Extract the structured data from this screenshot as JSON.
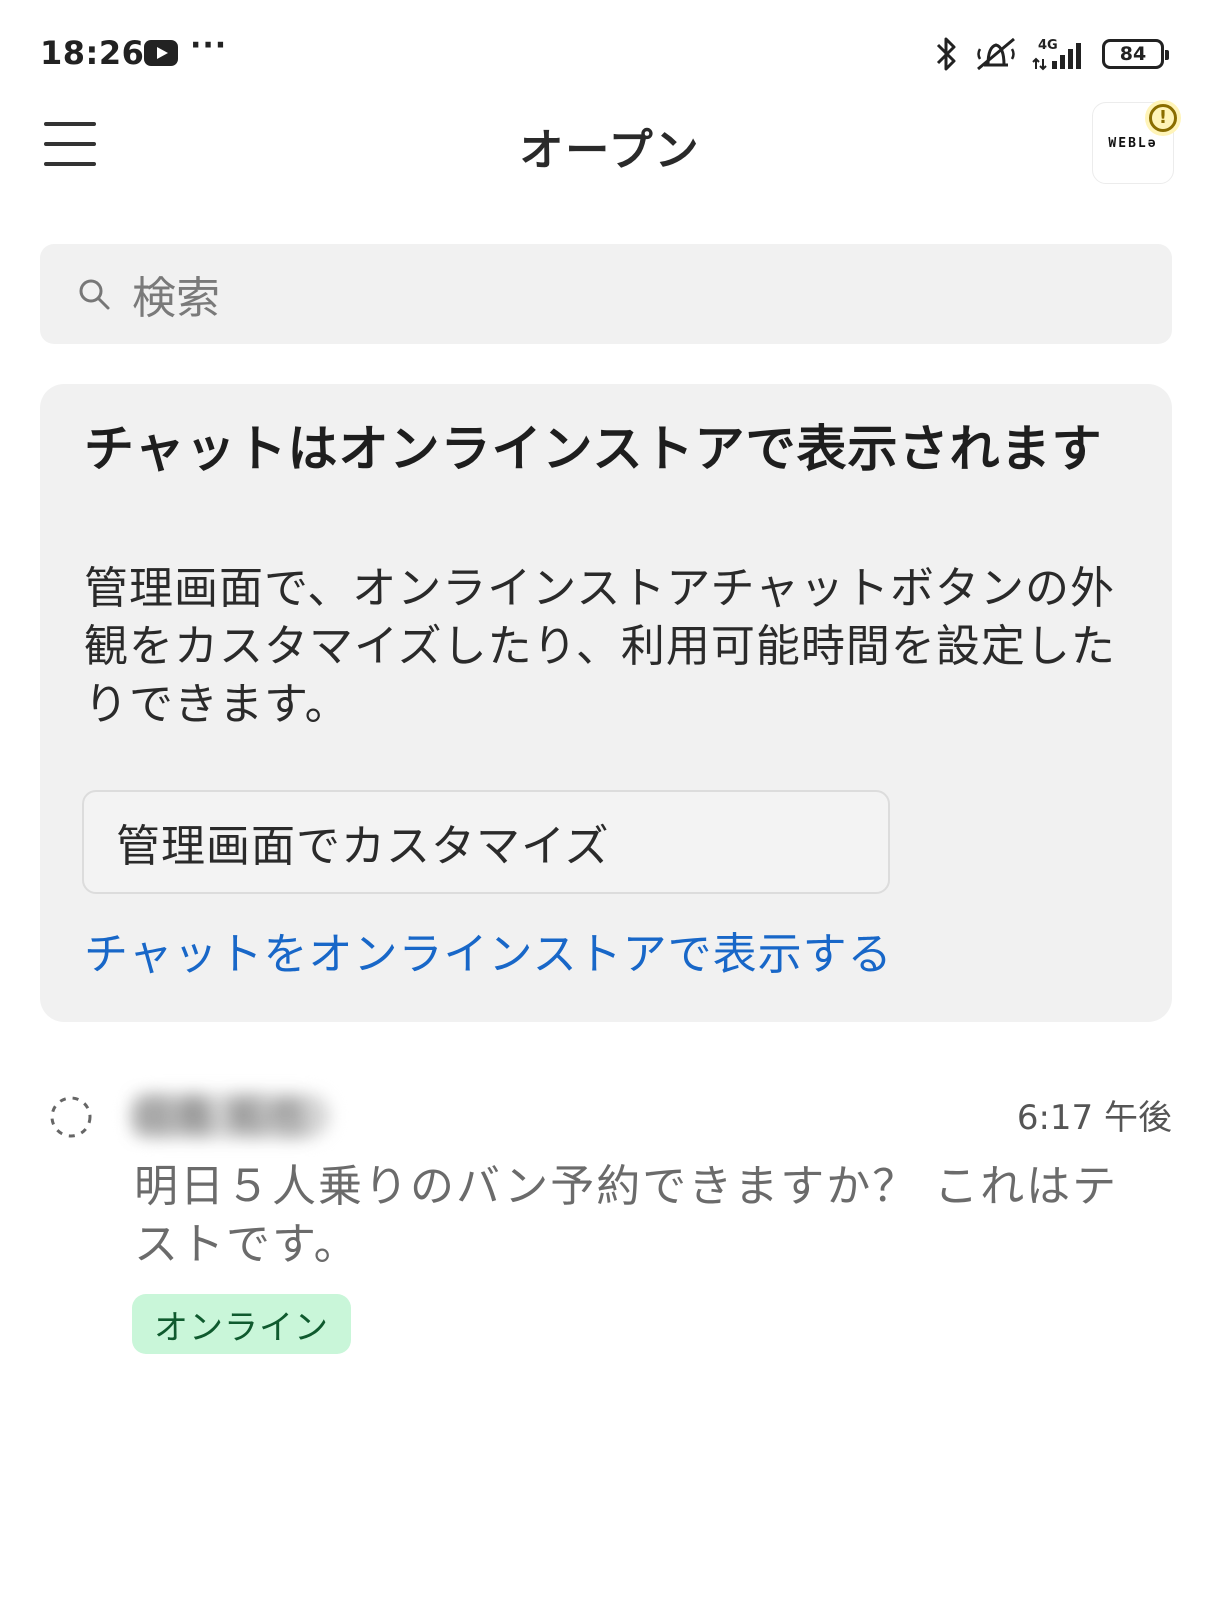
{
  "status_bar": {
    "time": "18:26",
    "more": "···",
    "network": "4G",
    "battery": "84"
  },
  "header": {
    "title": "オープン",
    "avatar_text": "WEBLə"
  },
  "search": {
    "placeholder": "検索"
  },
  "banner": {
    "title": "チャットはオンラインストアで表示されます",
    "body": "管理画面で、オンラインストアチャットボタンの外観をカスタマイズしたり、利用可能時間を設定したりできます。",
    "button_label": "管理画面でカスタマイズ",
    "link_label": "チャットをオンラインストアで表示する"
  },
  "conversations": [
    {
      "customer_name": "田島 拓也",
      "time": "6:17 午後",
      "preview": "明日５人乗りのバン予約できますか？ これはテストです。",
      "status_badge": "オンライン"
    }
  ],
  "colors": {
    "link": "#1867c8",
    "card_bg": "#f1f1f1",
    "online_badge_bg": "#c9f6d9",
    "online_badge_text": "#0f5a2e",
    "alert_badge": "#8a6d00"
  }
}
